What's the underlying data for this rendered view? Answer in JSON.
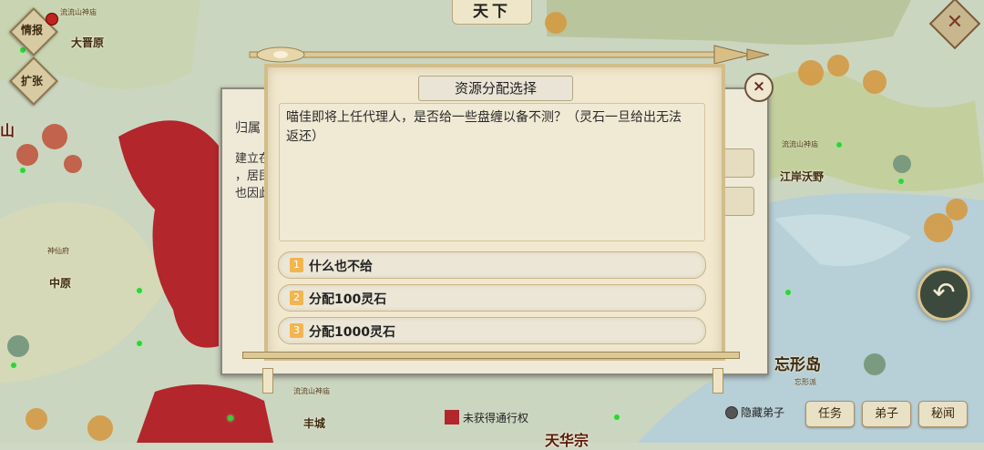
{
  "header": {
    "title": "天下"
  },
  "side_menu": {
    "intel": "情报",
    "expand": "扩张"
  },
  "map": {
    "regions": [
      {
        "name": "大晋原",
        "sub": "流流山神庙"
      },
      {
        "name": "中原",
        "sub": "神仙府"
      },
      {
        "name": "江岸沃野",
        "sub": "流流山神庙"
      },
      {
        "name": "丰城",
        "sub": "流流山神庙"
      },
      {
        "name": "忘形岛",
        "sub": "忘形派"
      }
    ],
    "edge_text": {
      "left_mountain": "山",
      "bottom": "天华宗"
    }
  },
  "background_panel": {
    "belongs_label": "归属",
    "text_line1": "建立在",
    "text_line2": "，居民",
    "text_line3": "也因此"
  },
  "dialog": {
    "title": "资源分配选择",
    "prompt": "喵佳即将上任代理人，是否给一些盘缠以备不测？（灵石一旦给出无法返还）",
    "options": [
      {
        "num": "1",
        "label": "什么也不给"
      },
      {
        "num": "2",
        "label": "分配100灵石"
      },
      {
        "num": "3",
        "label": "分配1000灵石"
      }
    ],
    "close_symbol": "×"
  },
  "bottom_bar": {
    "legend": "未获得通行权",
    "hide_disciples": "隐藏弟子",
    "tasks": "任务",
    "disciples": "弟子",
    "secrets": "秘闻"
  },
  "colors": {
    "territory_red": "#b2262c",
    "option_num_bg": "#f3b54f",
    "region_green_dot": "#2fd33a"
  }
}
